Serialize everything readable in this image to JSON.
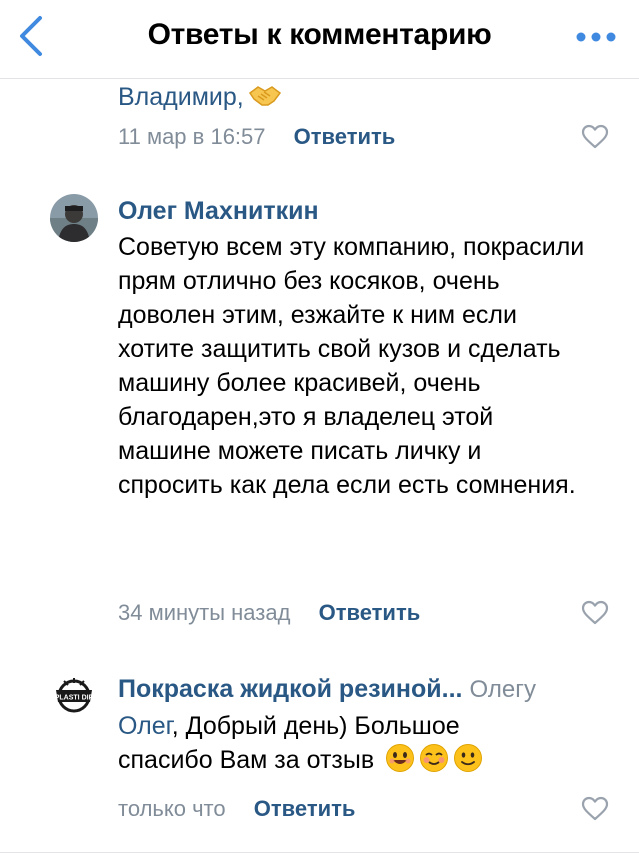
{
  "header": {
    "title": "Ответы к комментарию"
  },
  "comment1": {
    "text": "Владимир,",
    "time": "11 мар в 16:57",
    "reply_label": "Ответить"
  },
  "comment2": {
    "author": "Олег Махниткин",
    "text": "Советую всем эту компанию, покрасили прям отлично без косяков, очень доволен этим, езжайте к ним если хотите защитить свой кузов и сделать машину более красивей, очень благодарен,это я владелец этой машине можете писать личку и спросить как дела  если есть сомнения.",
    "time": "34 минуты назад",
    "reply_label": "Ответить"
  },
  "comment3": {
    "author": "Покраска жидкой резиной...",
    "reply_to": "Олегу",
    "mention": "Олег",
    "text_part1": ", Добрый день) Большое спасибо Вам за отзыв",
    "time": "только что",
    "reply_label": "Ответить",
    "avatar_text": "PLASTI DIP"
  },
  "colors": {
    "link": "#2a5885",
    "secondary": "#818c99",
    "accent": "#3f8ae0"
  },
  "icons": [
    "back-chevron-icon",
    "more-dots-icon",
    "handshake-icon",
    "heart-icon",
    "smile-emoji-icon",
    "blush-emoji-icon",
    "slight-smile-emoji-icon"
  ]
}
